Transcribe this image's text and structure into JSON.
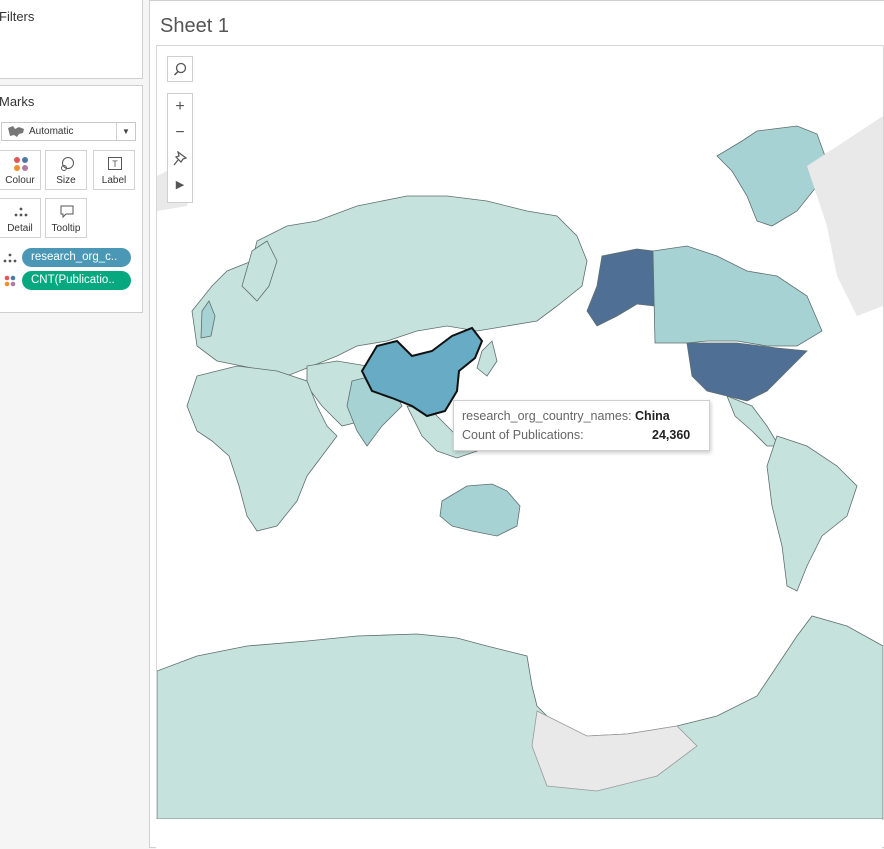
{
  "left_panel": {
    "filters_title": "Filters",
    "marks_title": "Marks",
    "mark_type": "Automatic",
    "buttons": {
      "colour": "Colour",
      "size": "Size",
      "label": "Label",
      "detail": "Detail",
      "tooltip": "Tooltip"
    },
    "pills": [
      {
        "label": "research_org_c..",
        "color": "#4a98b5",
        "icon": "detail-icon"
      },
      {
        "label": "CNT(Publicatio..",
        "color": "#06a97f",
        "icon": "colour-icon"
      }
    ]
  },
  "sheet": {
    "title": "Sheet 1"
  },
  "map_controls": {
    "search": "search-icon",
    "zoom_in": "+",
    "zoom_out": "−",
    "pin": "pin-icon",
    "expand": "▶"
  },
  "tooltip": {
    "field1_label": "research_org_country_names:",
    "field1_value": "China",
    "field2_label": "Count of Publications:",
    "field2_value": "24,360"
  },
  "colors": {
    "land_low": "#c6e2dd",
    "land_mid": "#a7d2d4",
    "land_china": "#67acc4",
    "land_high": "#4f6f94",
    "no_data": "#e9e9e9"
  }
}
